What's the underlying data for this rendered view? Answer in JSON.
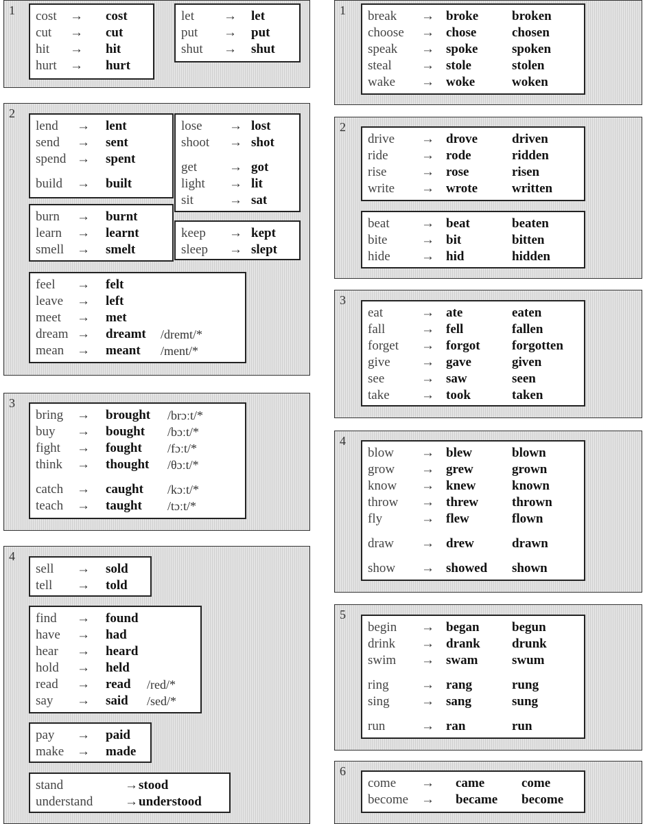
{
  "left": [
    {
      "number": "1",
      "boxes": [
        {
          "rows": [
            [
              "cost",
              "cost"
            ],
            [
              "cut",
              "cut"
            ],
            [
              "hit",
              "hit"
            ],
            [
              "hurt",
              "hurt"
            ]
          ]
        },
        {
          "rows": [
            [
              "let",
              "let"
            ],
            [
              "put",
              "put"
            ],
            [
              "shut",
              "shut"
            ]
          ]
        }
      ]
    },
    {
      "number": "2",
      "boxes": [
        {
          "rows": [
            [
              "lend",
              "lent"
            ],
            [
              "send",
              "sent"
            ],
            [
              "spend",
              "spent"
            ],
            [
              "build",
              "built"
            ]
          ]
        },
        {
          "rows": [
            [
              "lose",
              "lost"
            ],
            [
              "shoot",
              "shot"
            ],
            [
              "get",
              "got"
            ],
            [
              "light",
              "lit"
            ],
            [
              "sit",
              "sat"
            ]
          ]
        },
        {
          "rows": [
            [
              "burn",
              "burnt"
            ],
            [
              "learn",
              "learnt"
            ],
            [
              "smell",
              "smelt"
            ]
          ]
        },
        {
          "rows": [
            [
              "keep",
              "kept"
            ],
            [
              "sleep",
              "slept"
            ]
          ]
        },
        {
          "rows": [
            [
              "feel",
              "felt"
            ],
            [
              "leave",
              "left"
            ],
            [
              "meet",
              "met"
            ],
            [
              "dream",
              "dreamt",
              "/dremt/*"
            ],
            [
              "mean",
              "meant",
              "/ment/*"
            ]
          ]
        }
      ]
    },
    {
      "number": "3",
      "boxes": [
        {
          "rows": [
            [
              "bring",
              "brought",
              "/brɔːt/*"
            ],
            [
              "buy",
              "bought",
              "/bɔːt/*"
            ],
            [
              "fight",
              "fought",
              "/fɔːt/*"
            ],
            [
              "think",
              "thought",
              "/θɔːt/*"
            ],
            [
              "catch",
              "caught",
              "/kɔːt/*"
            ],
            [
              "teach",
              "taught",
              "/tɔːt/*"
            ]
          ]
        }
      ]
    },
    {
      "number": "4",
      "boxes": [
        {
          "rows": [
            [
              "sell",
              "sold"
            ],
            [
              "tell",
              "told"
            ]
          ]
        },
        {
          "rows": [
            [
              "find",
              "found"
            ],
            [
              "have",
              "had"
            ],
            [
              "hear",
              "heard"
            ],
            [
              "hold",
              "held"
            ],
            [
              "read",
              "read",
              "/red/*"
            ],
            [
              "say",
              "said",
              "/sed/*"
            ]
          ]
        },
        {
          "rows": [
            [
              "pay",
              "paid"
            ],
            [
              "make",
              "made"
            ]
          ]
        },
        {
          "rows": [
            [
              "stand",
              "stood"
            ],
            [
              "understand",
              "understood"
            ]
          ]
        }
      ]
    }
  ],
  "right": [
    {
      "number": "1",
      "boxes": [
        {
          "rows": [
            [
              "break",
              "broke",
              "broken"
            ],
            [
              "choose",
              "chose",
              "chosen"
            ],
            [
              "speak",
              "spoke",
              "spoken"
            ],
            [
              "steal",
              "stole",
              "stolen"
            ],
            [
              "wake",
              "woke",
              "woken"
            ]
          ]
        }
      ]
    },
    {
      "number": "2",
      "boxes": [
        {
          "rows": [
            [
              "drive",
              "drove",
              "driven"
            ],
            [
              "ride",
              "rode",
              "ridden"
            ],
            [
              "rise",
              "rose",
              "risen"
            ],
            [
              "write",
              "wrote",
              "written"
            ]
          ]
        },
        {
          "rows": [
            [
              "beat",
              "beat",
              "beaten"
            ],
            [
              "bite",
              "bit",
              "bitten"
            ],
            [
              "hide",
              "hid",
              "hidden"
            ]
          ]
        }
      ]
    },
    {
      "number": "3",
      "boxes": [
        {
          "rows": [
            [
              "eat",
              "ate",
              "eaten"
            ],
            [
              "fall",
              "fell",
              "fallen"
            ],
            [
              "forget",
              "forgot",
              "forgotten"
            ],
            [
              "give",
              "gave",
              "given"
            ],
            [
              "see",
              "saw",
              "seen"
            ],
            [
              "take",
              "took",
              "taken"
            ]
          ]
        }
      ]
    },
    {
      "number": "4",
      "boxes": [
        {
          "rows": [
            [
              "blow",
              "blew",
              "blown"
            ],
            [
              "grow",
              "grew",
              "grown"
            ],
            [
              "know",
              "knew",
              "known"
            ],
            [
              "throw",
              "threw",
              "thrown"
            ],
            [
              "fly",
              "flew",
              "flown"
            ],
            [
              "draw",
              "drew",
              "drawn"
            ],
            [
              "show",
              "showed",
              "shown"
            ]
          ]
        }
      ]
    },
    {
      "number": "5",
      "boxes": [
        {
          "rows": [
            [
              "begin",
              "began",
              "begun"
            ],
            [
              "drink",
              "drank",
              "drunk"
            ],
            [
              "swim",
              "swam",
              "swum"
            ],
            [
              "ring",
              "rang",
              "rung"
            ],
            [
              "sing",
              "sang",
              "sung"
            ],
            [
              "run",
              "ran",
              "run"
            ]
          ]
        }
      ]
    },
    {
      "number": "6",
      "boxes": [
        {
          "rows": [
            [
              "come",
              "came",
              "come"
            ],
            [
              "become",
              "became",
              "become"
            ]
          ]
        }
      ]
    }
  ],
  "arrow_glyph": "→"
}
